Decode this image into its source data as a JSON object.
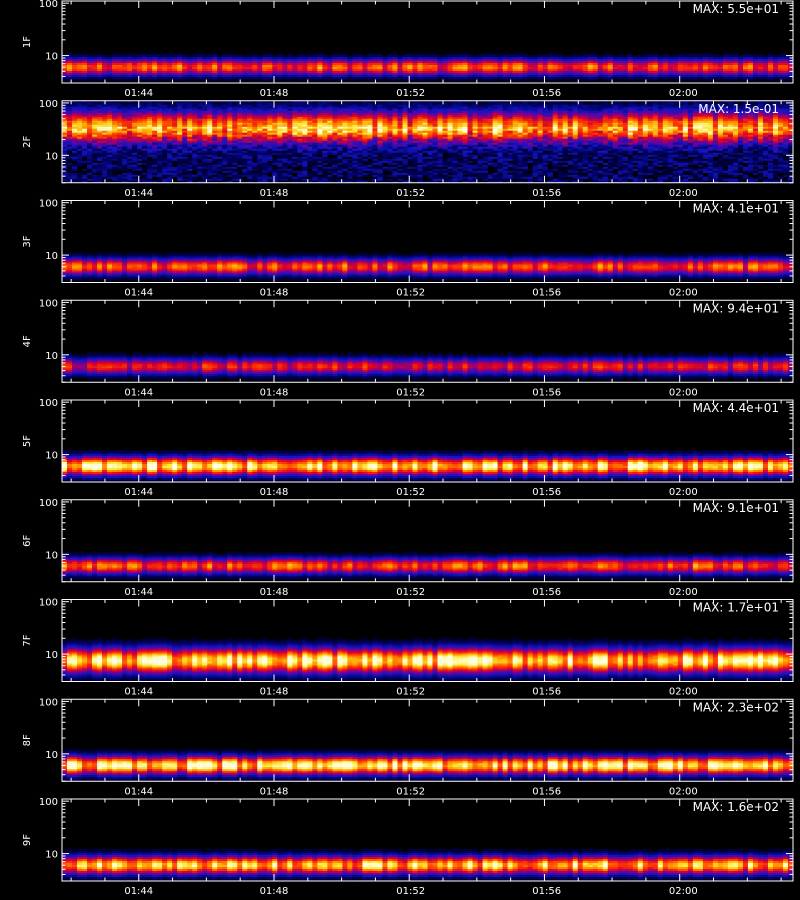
{
  "colors": {
    "background": "#000000",
    "axis": "#ffffff",
    "text": "#ffffff"
  },
  "chart_data": [
    {
      "type": "heatmap",
      "ylabel": "1F",
      "max_label": "MAX: 5.5e+01",
      "y_scale": "log",
      "y_range": [
        3,
        110
      ],
      "y_ticks": [
        "10",
        "100"
      ],
      "x_ticks": [
        "01:44",
        "01:48",
        "01:52",
        "01:56",
        "02:00"
      ],
      "band": {
        "center": 6,
        "intensity": 0.7,
        "width_decades": 0.25
      }
    },
    {
      "type": "heatmap",
      "ylabel": "2F",
      "max_label": "MAX: 1.5e-01",
      "y_scale": "log",
      "y_range": [
        3,
        110
      ],
      "y_ticks": [
        "10",
        "100"
      ],
      "x_ticks": [
        "01:44",
        "01:48",
        "01:52",
        "01:56",
        "02:00"
      ],
      "band": {
        "center": 35,
        "intensity": 0.75,
        "width_decades": 0.45
      },
      "noise_floor": 0.25
    },
    {
      "type": "heatmap",
      "ylabel": "3F",
      "max_label": "MAX: 4.1e+01",
      "y_scale": "log",
      "y_range": [
        3,
        110
      ],
      "y_ticks": [
        "10",
        "100"
      ],
      "x_ticks": [
        "01:44",
        "01:48",
        "01:52",
        "01:56",
        "02:00"
      ],
      "band": {
        "center": 6,
        "intensity": 0.7,
        "width_decades": 0.25
      }
    },
    {
      "type": "heatmap",
      "ylabel": "4F",
      "max_label": "MAX: 9.4e+01",
      "y_scale": "log",
      "y_range": [
        3,
        110
      ],
      "y_ticks": [
        "10",
        "100"
      ],
      "x_ticks": [
        "01:44",
        "01:48",
        "01:52",
        "01:56",
        "02:00"
      ],
      "band": {
        "center": 6,
        "intensity": 0.6,
        "width_decades": 0.25
      }
    },
    {
      "type": "heatmap",
      "ylabel": "5F",
      "max_label": "MAX: 4.4e+01",
      "y_scale": "log",
      "y_range": [
        3,
        110
      ],
      "y_ticks": [
        "10",
        "100"
      ],
      "x_ticks": [
        "01:44",
        "01:48",
        "01:52",
        "01:56",
        "02:00"
      ],
      "band": {
        "center": 6,
        "intensity": 0.92,
        "width_decades": 0.28
      }
    },
    {
      "type": "heatmap",
      "ylabel": "6F",
      "max_label": "MAX: 9.1e+01",
      "y_scale": "log",
      "y_range": [
        3,
        110
      ],
      "y_ticks": [
        "10",
        "100"
      ],
      "x_ticks": [
        "01:44",
        "01:48",
        "01:52",
        "01:56",
        "02:00"
      ],
      "band": {
        "center": 6,
        "intensity": 0.7,
        "width_decades": 0.25
      }
    },
    {
      "type": "heatmap",
      "ylabel": "7F",
      "max_label": "MAX: 1.7e+01",
      "y_scale": "log",
      "y_range": [
        3,
        110
      ],
      "y_ticks": [
        "10",
        "100"
      ],
      "x_ticks": [
        "01:44",
        "01:48",
        "01:52",
        "01:56",
        "02:00"
      ],
      "band": {
        "center": 7.5,
        "intensity": 0.92,
        "width_decades": 0.38
      }
    },
    {
      "type": "heatmap",
      "ylabel": "8F",
      "max_label": "MAX: 2.3e+02",
      "y_scale": "log",
      "y_range": [
        3,
        110
      ],
      "y_ticks": [
        "10",
        "100"
      ],
      "x_ticks": [
        "01:44",
        "01:48",
        "01:52",
        "01:56",
        "02:00"
      ],
      "band": {
        "center": 6,
        "intensity": 0.92,
        "width_decades": 0.28
      }
    },
    {
      "type": "heatmap",
      "ylabel": "9F",
      "max_label": "MAX: 1.6e+02",
      "y_scale": "log",
      "y_range": [
        3,
        110
      ],
      "y_ticks": [
        "10",
        "100"
      ],
      "x_ticks": [
        "01:44",
        "01:48",
        "01:52",
        "01:56",
        "02:00"
      ],
      "band": {
        "center": 6,
        "intensity": 0.85,
        "width_decades": 0.28
      }
    }
  ]
}
